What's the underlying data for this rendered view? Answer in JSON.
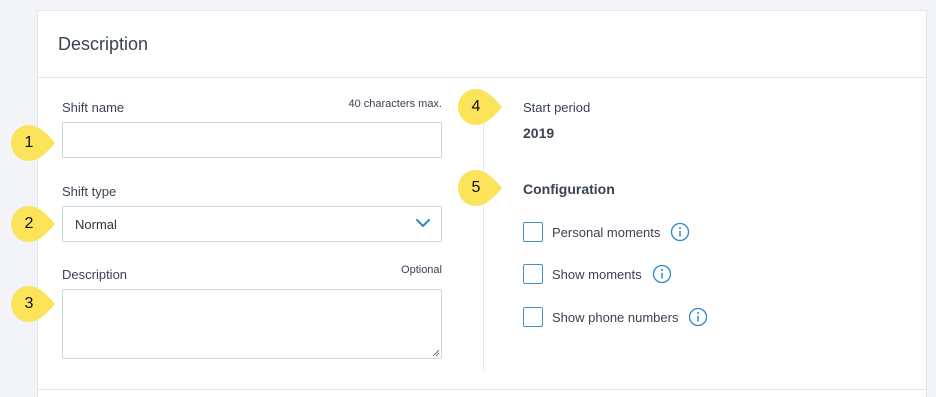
{
  "header": {
    "title": "Description"
  },
  "shift_name": {
    "label": "Shift name",
    "hint": "40 characters max.",
    "value": "",
    "placeholder": ""
  },
  "shift_type": {
    "label": "Shift type",
    "selected": "Normal"
  },
  "description": {
    "label": "Description",
    "hint": "Optional",
    "value": ""
  },
  "start_period": {
    "label": "Start period",
    "value": "2019"
  },
  "configuration": {
    "title": "Configuration",
    "options": [
      {
        "label": "Personal moments",
        "checked": false
      },
      {
        "label": "Show moments",
        "checked": false
      },
      {
        "label": "Show phone numbers",
        "checked": false
      }
    ]
  },
  "callouts": [
    "1",
    "2",
    "3",
    "4",
    "5"
  ],
  "colors": {
    "callout": "#fbe35a",
    "accent": "#2f86c8",
    "border": "#c6d9e3"
  },
  "icons": {
    "select_chevron": "chevron-down-icon",
    "info": "info-icon"
  }
}
